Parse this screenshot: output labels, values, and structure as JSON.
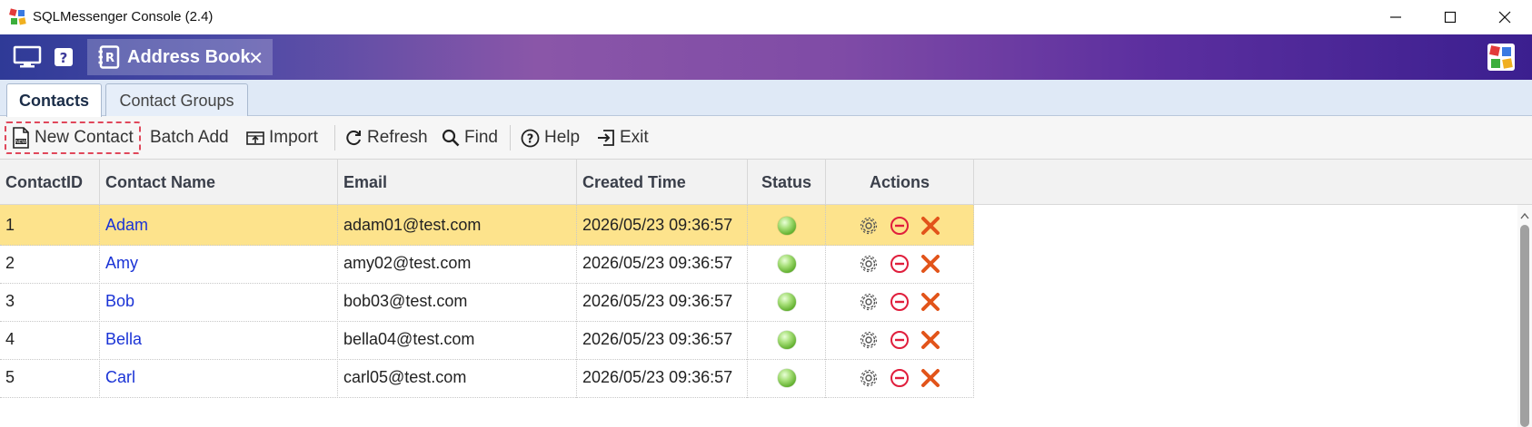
{
  "window": {
    "title": "SQLMessenger Console (2.4)",
    "controls": [
      "minimize-icon",
      "maximize-icon",
      "close-icon"
    ]
  },
  "banner": {
    "active_tab": "Address Book",
    "icons": [
      "monitor-icon",
      "help-icon",
      "address-book-icon",
      "close-tab-icon",
      "app-brand-icon"
    ]
  },
  "tabs": [
    {
      "label": "Contacts",
      "active": true
    },
    {
      "label": "Contact Groups",
      "active": false
    }
  ],
  "toolbar": {
    "new_contact": "New Contact",
    "batch_add": "Batch Add",
    "import": "Import",
    "refresh": "Refresh",
    "find": "Find",
    "help": "Help",
    "exit": "Exit"
  },
  "table": {
    "columns": [
      "ContactID",
      "Contact Name",
      "Email",
      "Created Time",
      "Status",
      "Actions"
    ],
    "rows": [
      {
        "id": "1",
        "name": "Adam",
        "email": "adam01@test.com",
        "created": "2026/05/23 09:36:57",
        "selected": true
      },
      {
        "id": "2",
        "name": "Amy",
        "email": "amy02@test.com",
        "created": "2026/05/23 09:36:57",
        "selected": false
      },
      {
        "id": "3",
        "name": "Bob",
        "email": "bob03@test.com",
        "created": "2026/05/23 09:36:57",
        "selected": false
      },
      {
        "id": "4",
        "name": "Bella",
        "email": "bella04@test.com",
        "created": "2026/05/23 09:36:57",
        "selected": false
      },
      {
        "id": "5",
        "name": "Carl",
        "email": "carl05@test.com",
        "created": "2026/05/23 09:36:57",
        "selected": false
      }
    ],
    "status_icon": "status-active-icon",
    "action_icons": [
      "settings-icon",
      "disable-icon",
      "delete-icon"
    ]
  },
  "colors": {
    "selected_row": "#fde38c",
    "link_text": "#1a33d6",
    "highlight_border": "#e0475a"
  }
}
